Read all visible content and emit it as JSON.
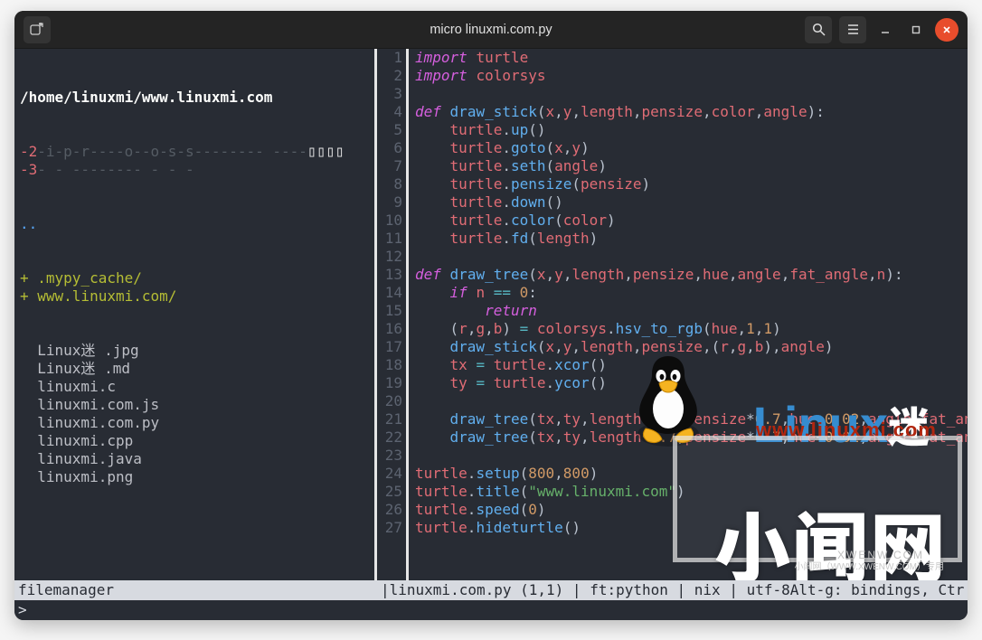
{
  "titlebar": {
    "title": "micro linuxmi.com.py"
  },
  "fm": {
    "path": "/home/linuxmi/www.linuxmi.com",
    "dashrows": [
      {
        "n": "-2",
        "flags": "-i-p-r----o--o-s-s-------- ----",
        "box": "▯▯▯▯"
      },
      {
        "n": "-3",
        "flags": "- - -------- - - -",
        "box": ""
      }
    ],
    "dots": "..",
    "dirs": [
      "+ .mypy_cache/",
      "+ www.linuxmi.com/"
    ],
    "files": [
      "  Linux迷 .jpg",
      "  Linux迷 .md",
      "  linuxmi.c",
      "  linuxmi.com.js",
      "  linuxmi.com.py",
      "  linuxmi.cpp",
      "  linuxmi.java",
      "  linuxmi.png"
    ]
  },
  "code": {
    "lines": [
      {
        "n": 1,
        "t": [
          [
            "kw",
            "import"
          ],
          [
            "pn",
            " "
          ],
          [
            "id",
            "turtle"
          ]
        ]
      },
      {
        "n": 2,
        "t": [
          [
            "kw",
            "import"
          ],
          [
            "pn",
            " "
          ],
          [
            "id",
            "colorsys"
          ]
        ]
      },
      {
        "n": 3,
        "t": []
      },
      {
        "n": 4,
        "t": [
          [
            "kw",
            "def"
          ],
          [
            "pn",
            " "
          ],
          [
            "fn",
            "draw_stick"
          ],
          [
            "pn",
            "("
          ],
          [
            "id",
            "x"
          ],
          [
            "pn",
            ","
          ],
          [
            "id",
            "y"
          ],
          [
            "pn",
            ","
          ],
          [
            "id",
            "length"
          ],
          [
            "pn",
            ","
          ],
          [
            "id",
            "pensize"
          ],
          [
            "pn",
            ","
          ],
          [
            "id",
            "color"
          ],
          [
            "pn",
            ","
          ],
          [
            "id",
            "angle"
          ],
          [
            "pn",
            "):"
          ]
        ]
      },
      {
        "n": 5,
        "t": [
          [
            "pn",
            "    "
          ],
          [
            "id",
            "turtle"
          ],
          [
            "pn",
            "."
          ],
          [
            "fn",
            "up"
          ],
          [
            "pn",
            "()"
          ]
        ]
      },
      {
        "n": 6,
        "t": [
          [
            "pn",
            "    "
          ],
          [
            "id",
            "turtle"
          ],
          [
            "pn",
            "."
          ],
          [
            "fn",
            "goto"
          ],
          [
            "pn",
            "("
          ],
          [
            "id",
            "x"
          ],
          [
            "pn",
            ","
          ],
          [
            "id",
            "y"
          ],
          [
            "pn",
            ")"
          ]
        ]
      },
      {
        "n": 7,
        "t": [
          [
            "pn",
            "    "
          ],
          [
            "id",
            "turtle"
          ],
          [
            "pn",
            "."
          ],
          [
            "fn",
            "seth"
          ],
          [
            "pn",
            "("
          ],
          [
            "id",
            "angle"
          ],
          [
            "pn",
            ")"
          ]
        ]
      },
      {
        "n": 8,
        "t": [
          [
            "pn",
            "    "
          ],
          [
            "id",
            "turtle"
          ],
          [
            "pn",
            "."
          ],
          [
            "fn",
            "pensize"
          ],
          [
            "pn",
            "("
          ],
          [
            "id",
            "pensize"
          ],
          [
            "pn",
            ")"
          ]
        ]
      },
      {
        "n": 9,
        "t": [
          [
            "pn",
            "    "
          ],
          [
            "id",
            "turtle"
          ],
          [
            "pn",
            "."
          ],
          [
            "fn",
            "down"
          ],
          [
            "pn",
            "()"
          ]
        ]
      },
      {
        "n": 10,
        "t": [
          [
            "pn",
            "    "
          ],
          [
            "id",
            "turtle"
          ],
          [
            "pn",
            "."
          ],
          [
            "fn",
            "color"
          ],
          [
            "pn",
            "("
          ],
          [
            "id",
            "color"
          ],
          [
            "pn",
            ")"
          ]
        ]
      },
      {
        "n": 11,
        "t": [
          [
            "pn",
            "    "
          ],
          [
            "id",
            "turtle"
          ],
          [
            "pn",
            "."
          ],
          [
            "fn",
            "fd"
          ],
          [
            "pn",
            "("
          ],
          [
            "id",
            "length"
          ],
          [
            "pn",
            ")"
          ]
        ]
      },
      {
        "n": 12,
        "t": []
      },
      {
        "n": 13,
        "t": [
          [
            "kw",
            "def"
          ],
          [
            "pn",
            " "
          ],
          [
            "fn",
            "draw_tree"
          ],
          [
            "pn",
            "("
          ],
          [
            "id",
            "x"
          ],
          [
            "pn",
            ","
          ],
          [
            "id",
            "y"
          ],
          [
            "pn",
            ","
          ],
          [
            "id",
            "length"
          ],
          [
            "pn",
            ","
          ],
          [
            "id",
            "pensize"
          ],
          [
            "pn",
            ","
          ],
          [
            "id",
            "hue"
          ],
          [
            "pn",
            ","
          ],
          [
            "id",
            "angle"
          ],
          [
            "pn",
            ","
          ],
          [
            "id",
            "fat_angle"
          ],
          [
            "pn",
            ","
          ],
          [
            "id",
            "n"
          ],
          [
            "pn",
            "):"
          ]
        ]
      },
      {
        "n": 14,
        "t": [
          [
            "pn",
            "    "
          ],
          [
            "kw",
            "if"
          ],
          [
            "pn",
            " "
          ],
          [
            "id",
            "n"
          ],
          [
            "pn",
            " "
          ],
          [
            "op",
            "=="
          ],
          [
            "pn",
            " "
          ],
          [
            "num",
            "0"
          ],
          [
            "pn",
            ":"
          ]
        ]
      },
      {
        "n": 15,
        "t": [
          [
            "pn",
            "        "
          ],
          [
            "kw",
            "return"
          ]
        ]
      },
      {
        "n": 16,
        "t": [
          [
            "pn",
            "    ("
          ],
          [
            "id",
            "r"
          ],
          [
            "pn",
            ","
          ],
          [
            "id",
            "g"
          ],
          [
            "pn",
            ","
          ],
          [
            "id",
            "b"
          ],
          [
            "pn",
            ") "
          ],
          [
            "op",
            "="
          ],
          [
            "pn",
            " "
          ],
          [
            "id",
            "colorsys"
          ],
          [
            "pn",
            "."
          ],
          [
            "fn",
            "hsv_to_rgb"
          ],
          [
            "pn",
            "("
          ],
          [
            "id",
            "hue"
          ],
          [
            "pn",
            ","
          ],
          [
            "num",
            "1"
          ],
          [
            "pn",
            ","
          ],
          [
            "num",
            "1"
          ],
          [
            "pn",
            ")"
          ]
        ]
      },
      {
        "n": 17,
        "t": [
          [
            "pn",
            "    "
          ],
          [
            "fn",
            "draw_stick"
          ],
          [
            "pn",
            "("
          ],
          [
            "id",
            "x"
          ],
          [
            "pn",
            ","
          ],
          [
            "id",
            "y"
          ],
          [
            "pn",
            ","
          ],
          [
            "id",
            "length"
          ],
          [
            "pn",
            ","
          ],
          [
            "id",
            "pensize"
          ],
          [
            "pn",
            ",("
          ],
          [
            "id",
            "r"
          ],
          [
            "pn",
            ","
          ],
          [
            "id",
            "g"
          ],
          [
            "pn",
            ","
          ],
          [
            "id",
            "b"
          ],
          [
            "pn",
            "),"
          ],
          [
            "id",
            "angle"
          ],
          [
            "pn",
            ")"
          ]
        ]
      },
      {
        "n": 18,
        "t": [
          [
            "pn",
            "    "
          ],
          [
            "id",
            "tx"
          ],
          [
            "pn",
            " "
          ],
          [
            "op",
            "="
          ],
          [
            "pn",
            " "
          ],
          [
            "id",
            "turtle"
          ],
          [
            "pn",
            "."
          ],
          [
            "fn",
            "xcor"
          ],
          [
            "pn",
            "()"
          ]
        ]
      },
      {
        "n": 19,
        "t": [
          [
            "pn",
            "    "
          ],
          [
            "id",
            "ty"
          ],
          [
            "pn",
            " "
          ],
          [
            "op",
            "="
          ],
          [
            "pn",
            " "
          ],
          [
            "id",
            "turtle"
          ],
          [
            "pn",
            "."
          ],
          [
            "fn",
            "ycor"
          ],
          [
            "pn",
            "()"
          ]
        ]
      },
      {
        "n": 20,
        "t": []
      },
      {
        "n": 21,
        "t": [
          [
            "pn",
            "    "
          ],
          [
            "fn",
            "draw_tree"
          ],
          [
            "pn",
            "("
          ],
          [
            "id",
            "tx"
          ],
          [
            "pn",
            ","
          ],
          [
            "id",
            "ty"
          ],
          [
            "pn",
            ","
          ],
          [
            "id",
            "length"
          ],
          [
            "pn",
            "*"
          ],
          [
            "num",
            "0.7"
          ],
          [
            "pn",
            ","
          ],
          [
            "id",
            "pensize"
          ],
          [
            "pn",
            "*"
          ],
          [
            "num",
            "0.7"
          ],
          [
            "pn",
            ","
          ],
          [
            "id",
            "hue"
          ],
          [
            "pn",
            "+"
          ],
          [
            "num",
            "0.02"
          ],
          [
            "pn",
            ","
          ],
          [
            "id",
            "angle"
          ],
          [
            "pn",
            "+"
          ],
          [
            "id",
            "fat_an"
          ]
        ]
      },
      {
        "n": 22,
        "t": [
          [
            "pn",
            "    "
          ],
          [
            "fn",
            "draw_tree"
          ],
          [
            "pn",
            "("
          ],
          [
            "id",
            "tx"
          ],
          [
            "pn",
            ","
          ],
          [
            "id",
            "ty"
          ],
          [
            "pn",
            ","
          ],
          [
            "id",
            "length"
          ],
          [
            "pn",
            "*"
          ],
          [
            "num",
            "0.7"
          ],
          [
            "pn",
            ","
          ],
          [
            "id",
            "pensize"
          ],
          [
            "pn",
            "*"
          ],
          [
            "num",
            "0.7"
          ],
          [
            "pn",
            ","
          ],
          [
            "id",
            "hue"
          ],
          [
            "pn",
            "+"
          ],
          [
            "num",
            "0.02"
          ],
          [
            "pn",
            ","
          ],
          [
            "id",
            "angle"
          ],
          [
            "pn",
            "-"
          ],
          [
            "id",
            "fat_an"
          ]
        ]
      },
      {
        "n": 23,
        "t": []
      },
      {
        "n": 24,
        "t": [
          [
            "id",
            "turtle"
          ],
          [
            "pn",
            "."
          ],
          [
            "fn",
            "setup"
          ],
          [
            "pn",
            "("
          ],
          [
            "num",
            "800"
          ],
          [
            "pn",
            ","
          ],
          [
            "num",
            "800"
          ],
          [
            "pn",
            ")"
          ]
        ]
      },
      {
        "n": 25,
        "t": [
          [
            "id",
            "turtle"
          ],
          [
            "pn",
            "."
          ],
          [
            "fn",
            "title"
          ],
          [
            "pn",
            "("
          ],
          [
            "str",
            "\"www.linuxmi.com\""
          ],
          [
            "pn",
            ")"
          ]
        ]
      },
      {
        "n": 26,
        "t": [
          [
            "id",
            "turtle"
          ],
          [
            "pn",
            "."
          ],
          [
            "fn",
            "speed"
          ],
          [
            "pn",
            "("
          ],
          [
            "num",
            "0"
          ],
          [
            "pn",
            ")"
          ]
        ]
      },
      {
        "n": 27,
        "t": [
          [
            "id",
            "turtle"
          ],
          [
            "pn",
            "."
          ],
          [
            "fn",
            "hideturtle"
          ],
          [
            "pn",
            "()"
          ]
        ]
      }
    ]
  },
  "status": {
    "left": "filemanager",
    "right": "|linuxmi.com.py (1,1) | ft:python |   nix | utf-8Alt-g: bindings, Ctr"
  },
  "prompt": "> ",
  "watermark": {
    "brand": "Linux",
    "brand_suffix": "迷",
    "url": "www.linuxmi.com",
    "big": "小闻网",
    "xw": "XWENW.COM",
    "sub": "小闻网（WWW.XWENW.COM）专用"
  }
}
